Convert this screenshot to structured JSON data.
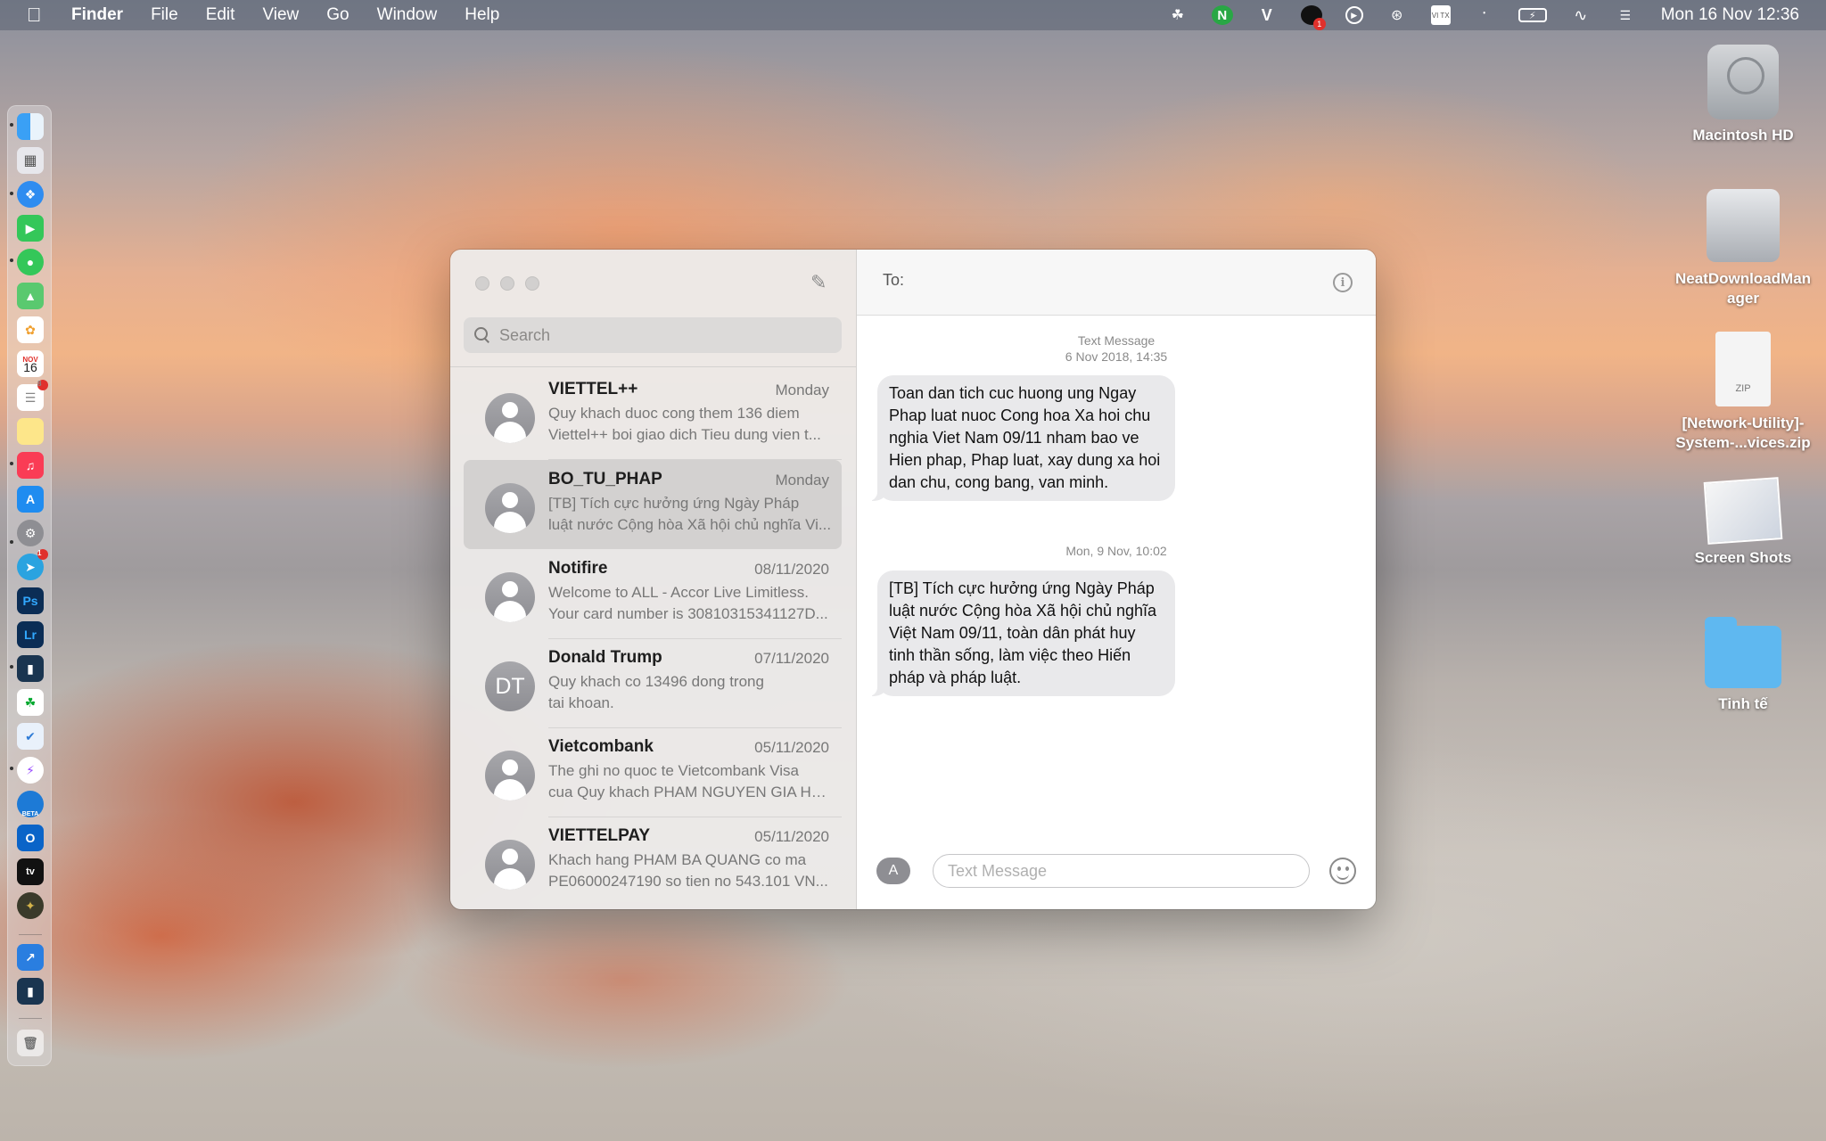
{
  "menubar": {
    "app_name": "Finder",
    "menus": [
      "File",
      "Edit",
      "View",
      "Go",
      "Window",
      "Help"
    ],
    "status_icons": [
      "evernote-icon",
      "n-icon",
      "v-icon",
      "notification-icon",
      "play-icon",
      "airdrop-icon",
      "keyboard-vi-icon",
      "bluetooth-icon",
      "battery-icon",
      "wifi-icon",
      "control-center-icon"
    ],
    "n_label": "N",
    "v_label": "V",
    "vi_label": "VI TX",
    "badge": "1",
    "clock": "Mon 16 Nov  12:36"
  },
  "dock": {
    "calendar_month": "NOV",
    "calendar_day": "16",
    "ps_label": "Ps",
    "lr_label": "Lr",
    "beta_label": "BETA",
    "tv_label": "tv",
    "badges": [
      "8",
      "1"
    ]
  },
  "desktop": {
    "items": [
      {
        "label": "Macintosh HD"
      },
      {
        "label": "NeatDownloadManager"
      },
      {
        "label": "[Network-Utility]-System-...vices.zip",
        "badge": "ZIP"
      },
      {
        "label": "Screen Shots"
      },
      {
        "label": "Tinh tế"
      }
    ]
  },
  "sidebar": {
    "search_placeholder": "Search",
    "conversations": [
      {
        "name": "VIETTEL++",
        "date": "Monday",
        "line1": "Quy khach duoc cong them 136 diem",
        "line2": "Viettel++ boi giao dich Tieu dung vien t...",
        "avatar": ""
      },
      {
        "name": "BO_TU_PHAP",
        "date": "Monday",
        "line1": "[TB] Tích cực hưởng ứng Ngày Pháp",
        "line2": "luật nước Cộng hòa Xã hội chủ nghĩa Vi...",
        "avatar": "",
        "selected": true
      },
      {
        "name": "Notifire",
        "date": "08/11/2020",
        "line1": "Welcome to ALL - Accor Live Limitless.",
        "line2": "Your card number is 30810315341127D...",
        "avatar": ""
      },
      {
        "name": "Donald Trump",
        "date": "07/11/2020",
        "line1": "Quy khach co 13496 dong trong",
        "line2": "tai khoan.",
        "avatar": "DT"
      },
      {
        "name": "Vietcombank",
        "date": "05/11/2020",
        "line1": "The ghi no quoc te Vietcombank Visa",
        "line2": "cua Quy khach PHAM NGUYEN GIA HU...",
        "avatar": ""
      },
      {
        "name": "VIETTELPAY",
        "date": "05/11/2020",
        "line1": "Khach hang PHAM BA QUANG co ma",
        "line2": "PE06000247190 so tien no 543.101 VN...",
        "avatar": ""
      }
    ]
  },
  "chat": {
    "to_label": "To:",
    "timestamp1_service": "Text Message",
    "timestamp1_date": "6 Nov 2018, 14:35",
    "message1": "Toan dan tich cuc huong ung Ngay Phap luat nuoc Cong hoa Xa hoi chu nghia Viet Nam 09/11 nham bao ve Hien phap, Phap luat, xay dung xa hoi dan chu, cong bang, van minh.",
    "timestamp2": "Mon, 9 Nov, 10:02",
    "message2": "[TB] Tích cực hưởng ứng Ngày Pháp luật nước Cộng hòa Xã hội chủ nghĩa Việt Nam 09/11, toàn dân phát huy tinh thần sống, làm việc theo Hiến pháp và pháp luật.",
    "input_placeholder": "Text Message"
  }
}
